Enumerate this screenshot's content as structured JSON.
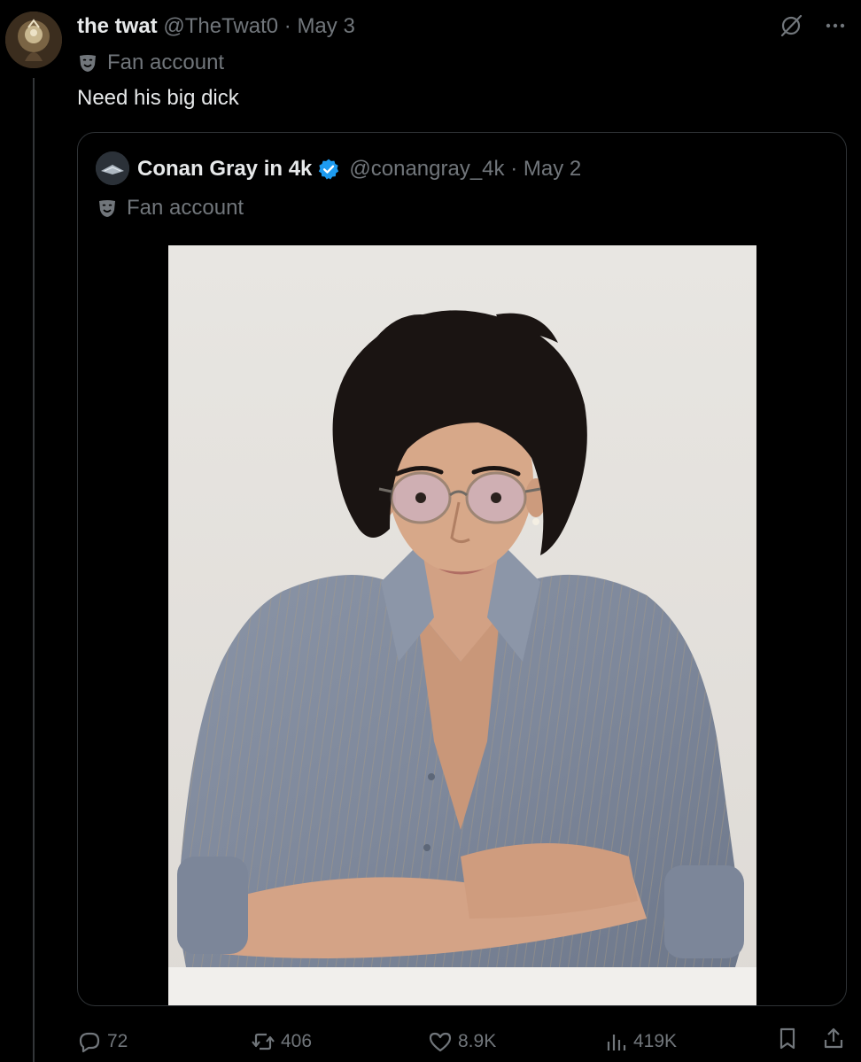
{
  "tweet": {
    "author": {
      "display_name": "the twat",
      "handle": "@TheTwat0",
      "date": "May 3",
      "label": "Fan account",
      "avatar_icon": "avatar"
    },
    "text": "Need his big dick",
    "top_icons": [
      "grok-icon",
      "more-icon"
    ]
  },
  "quote": {
    "author": {
      "display_name": "Conan Gray in 4k",
      "handle": "@conangray_4k",
      "date": "May 2",
      "label": "Fan account",
      "verified": true
    },
    "media": {
      "icon": "photo-portrait"
    }
  },
  "actions": {
    "replies": "72",
    "reposts": "406",
    "likes": "8.9K",
    "views": "419K"
  },
  "colors": {
    "background": "#000000",
    "text_primary": "#e7e9ea",
    "text_muted": "#71767b",
    "border": "#2f3336",
    "verified_blue": "#1d9bf0"
  }
}
